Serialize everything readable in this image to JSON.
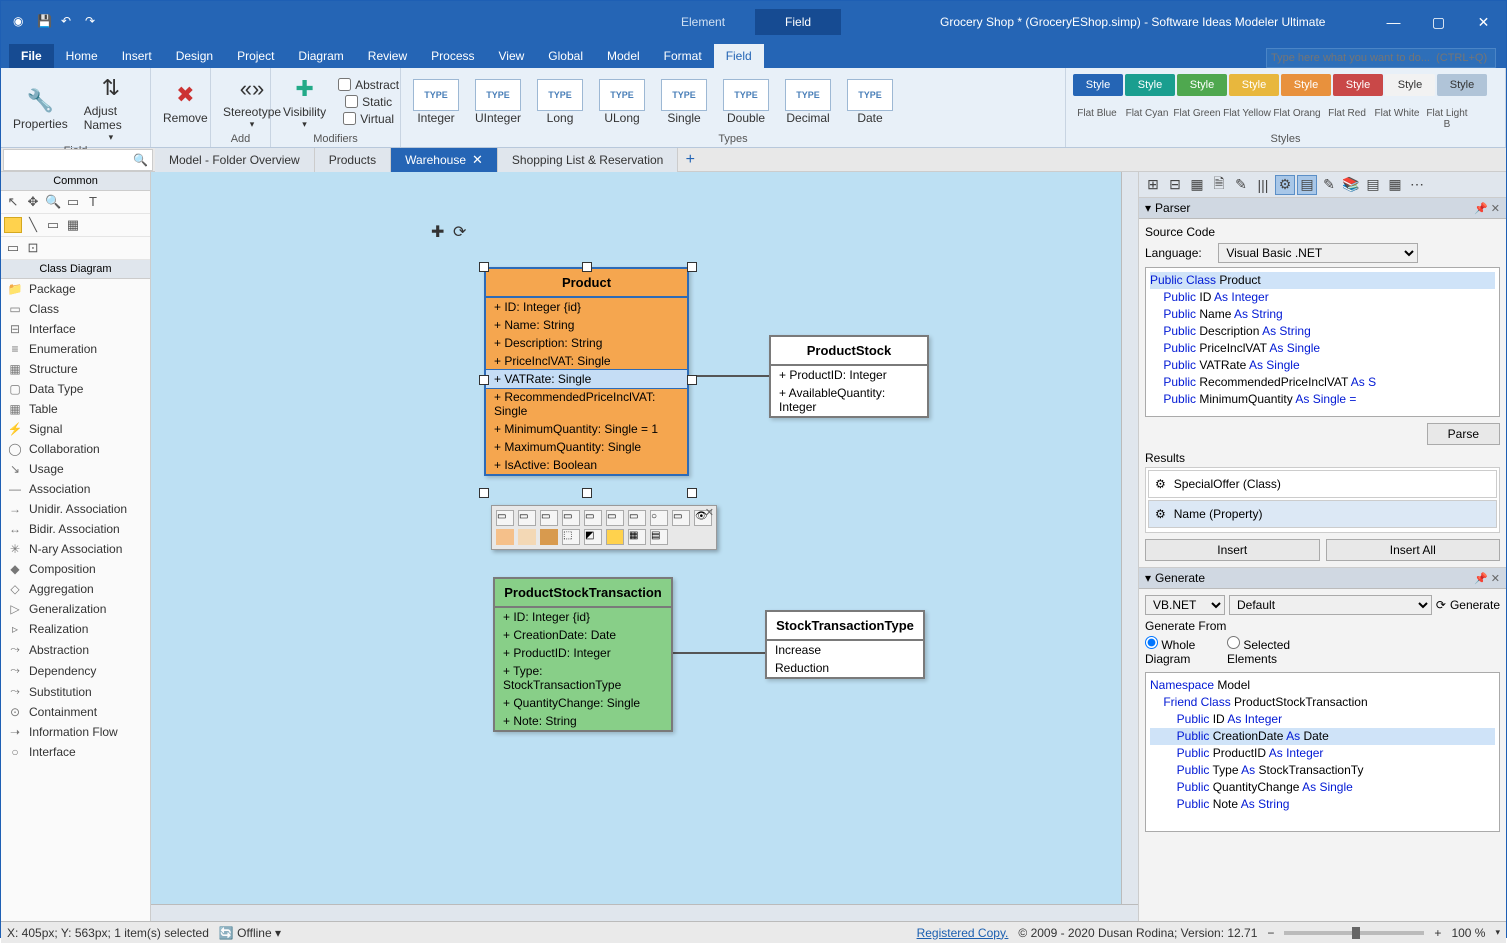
{
  "titlebar": {
    "context_tabs": [
      "Element",
      "Field"
    ],
    "context_active": 1,
    "title": "Grocery Shop * (GroceryEShop.simp) - Software Ideas Modeler Ultimate"
  },
  "menu": {
    "tabs": [
      "File",
      "Home",
      "Insert",
      "Design",
      "Project",
      "Diagram",
      "Review",
      "Process",
      "View",
      "Global",
      "Model",
      "Format",
      "Field"
    ],
    "active": "Field",
    "search_placeholder": "Type here what you want to do...  (CTRL+Q)"
  },
  "ribbon": {
    "properties": "Properties",
    "adjust_names": "Adjust Names",
    "remove": "Remove",
    "stereotype": "Stereotype",
    "visibility": "Visibility",
    "modifiers": {
      "abstract": "Abstract",
      "static": "Static",
      "virtual": "Virtual"
    },
    "types": [
      {
        "name": "Integer"
      },
      {
        "name": "UInteger"
      },
      {
        "name": "Long"
      },
      {
        "name": "ULong"
      },
      {
        "name": "Single"
      },
      {
        "name": "Double"
      },
      {
        "name": "Decimal"
      },
      {
        "name": "Date"
      }
    ],
    "type_glyph": "TYPE",
    "styles_label": "Style",
    "styles": [
      {
        "name": "Flat Blue",
        "bg": "#2565b5"
      },
      {
        "name": "Flat Cyan",
        "bg": "#1a9e8f"
      },
      {
        "name": "Flat Green",
        "bg": "#4fa84f"
      },
      {
        "name": "Flat Yellow",
        "bg": "#e8b73d"
      },
      {
        "name": "Flat Orang",
        "bg": "#e8913d"
      },
      {
        "name": "Flat Red",
        "bg": "#c94848"
      },
      {
        "name": "Flat White",
        "bg": "#f2f2f2",
        "fg": "#333"
      },
      {
        "name": "Flat Light B",
        "bg": "#b0c4d8",
        "fg": "#333"
      }
    ],
    "groups": {
      "field": "Field",
      "add": "Add",
      "modifiers": "Modifiers",
      "types": "Types",
      "styles": "Styles"
    }
  },
  "doctabs": {
    "items": [
      {
        "label": "Model - Folder Overview"
      },
      {
        "label": "Products"
      },
      {
        "label": "Warehouse",
        "active": true
      },
      {
        "label": "Shopping List & Reservation"
      }
    ]
  },
  "leftpane": {
    "common": "Common",
    "classdiagram": "Class Diagram",
    "items": [
      "Package",
      "Class",
      "Interface",
      "Enumeration",
      "Structure",
      "Data Type",
      "Table",
      "Signal",
      "Collaboration",
      "Usage",
      "Association",
      "Unidir. Association",
      "Bidir. Association",
      "N-ary Association",
      "Composition",
      "Aggregation",
      "Generalization",
      "Realization",
      "Abstraction",
      "Dependency",
      "Substitution",
      "Containment",
      "Information Flow",
      "Interface"
    ]
  },
  "canvas": {
    "product": {
      "name": "Product",
      "attrs": [
        "+ ID: Integer {id}",
        "+ Name: String",
        "+ Description: String",
        "+ PriceInclVAT: Single",
        "+ VATRate: Single",
        "+ RecommendedPriceInclVAT: Single",
        "+ MinimumQuantity: Single = 1",
        "+ MaximumQuantity: Single",
        "+ IsActive: Boolean"
      ],
      "sel_index": 4
    },
    "productstock": {
      "name": "ProductStock",
      "attrs": [
        "+ ProductID: Integer",
        "+ AvailableQuantity: Integer"
      ]
    },
    "pst": {
      "name": "ProductStockTransaction",
      "attrs": [
        "+ ID: Integer {id}",
        "+ CreationDate: Date",
        "+ ProductID: Integer",
        "+ Type: StockTransactionType",
        "+ QuantityChange: Single",
        "+ Note: String"
      ]
    },
    "stt": {
      "name": "StockTransactionType",
      "attrs": [
        "Increase",
        "Reduction"
      ]
    }
  },
  "parser": {
    "title": "Parser",
    "source_code": "Source Code",
    "language": "Language:",
    "language_value": "Visual Basic .NET",
    "parse": "Parse",
    "results": "Results",
    "result_items": [
      "SpecialOffer (Class)",
      "Name (Property)"
    ],
    "insert": "Insert",
    "insert_all": "Insert All",
    "code_lines": [
      {
        "t": "Public Class ",
        "t2": "Product",
        "hl": true
      },
      {
        "t": ""
      },
      {
        "t": "    Public ",
        "id": "ID",
        "kw2": " As Integer"
      },
      {
        "t": "    Public ",
        "id": "Name",
        "kw2": " As String"
      },
      {
        "t": "    Public ",
        "id": "Description",
        "kw2": " As String"
      },
      {
        "t": "    Public ",
        "id": "PriceInclVAT",
        "kw2": " As Single"
      },
      {
        "t": "    Public ",
        "id": "VATRate",
        "kw2": " As Single"
      },
      {
        "t": "    Public ",
        "id": "RecommendedPriceInclVAT",
        "kw2": " As S"
      },
      {
        "t": "    Public ",
        "id": "MinimumQuantity",
        "kw2": " As Single = "
      }
    ]
  },
  "generate": {
    "title": "Generate",
    "lang": "VB.NET",
    "template": "Default",
    "generate_btn": "Generate",
    "generate_from": "Generate From",
    "whole": "Whole Diagram",
    "selected": "Selected Elements",
    "code_lines": [
      {
        "pre": "Namespace ",
        "id": "Model"
      },
      {
        "pre": "    Friend Class ",
        "id": "ProductStockTransaction"
      },
      {
        "pre": ""
      },
      {
        "pre": "        Public ",
        "id": "ID",
        "kw": " As Integer"
      },
      {
        "pre": "        Public ",
        "id": "CreationDate",
        "kw": " As ",
        "id2": "Date",
        "hl": true
      },
      {
        "pre": "        Public ",
        "id": "ProductID",
        "kw": " As Integer"
      },
      {
        "pre": "        Public ",
        "id": "Type",
        "kw": " As ",
        "id2": "StockTransactionTy"
      },
      {
        "pre": "        Public ",
        "id": "QuantityChange",
        "kw": " As Single"
      },
      {
        "pre": "        Public ",
        "id": "Note",
        "kw": " As String"
      }
    ]
  },
  "status": {
    "coords": "X: 405px; Y: 563px; 1 item(s) selected",
    "offline": "Offline",
    "registered": "Registered Copy.",
    "copyright": "© 2009 - 2020 Dusan Rodina; Version: 12.71",
    "zoom": "100 %"
  }
}
